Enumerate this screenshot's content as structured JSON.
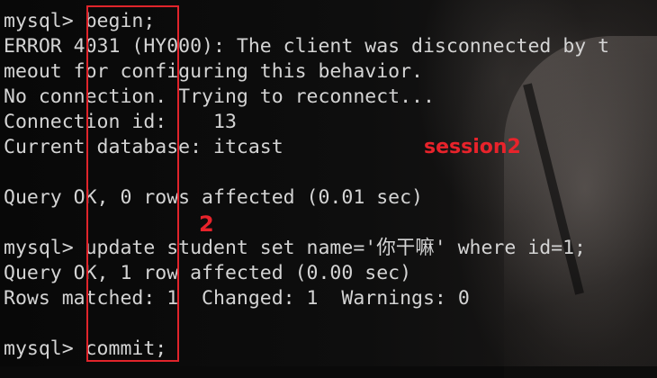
{
  "terminal": {
    "lines": [
      "mysql> begin;",
      "ERROR 4031 (HY000): The client was disconnected by t",
      "meout for configuring this behavior.",
      "No connection. Trying to reconnect...",
      "Connection id:    13",
      "Current database: itcast",
      "",
      "Query OK, 0 rows affected (0.01 sec)",
      "",
      "mysql> update student set name='你干嘛' where id=1;",
      "Query OK, 1 row affected (0.00 sec)",
      "Rows matched: 1  Changed: 1  Warnings: 0",
      "",
      "mysql> commit;"
    ]
  },
  "annotations": {
    "session_label": "session2",
    "step_number": "2"
  },
  "colors": {
    "terminal_text": "#d4d4d4",
    "annotation_red": "#e0242b",
    "background": "#0a0a0a"
  }
}
